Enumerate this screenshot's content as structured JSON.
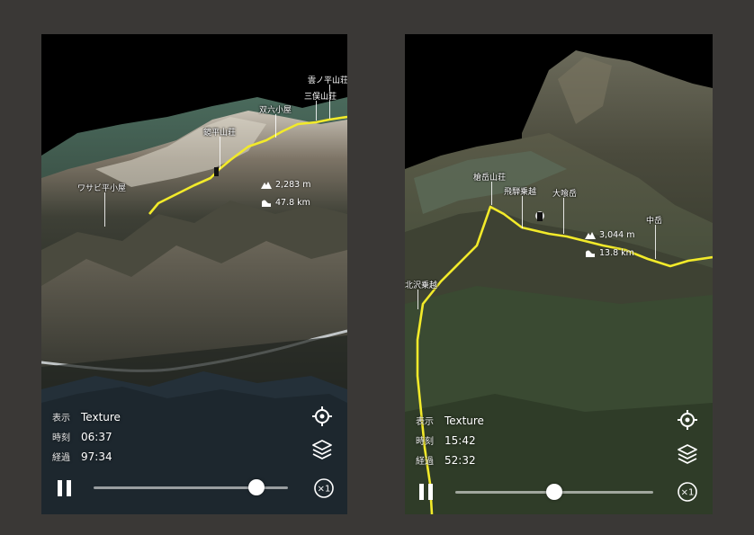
{
  "left": {
    "labels": {
      "kumonotaira": "雲ノ平山荘",
      "mitsumata": "三俣山荘",
      "sugoroku": "双六小屋",
      "kagami": "鏡平山荘",
      "wasabi": "ワサビ平小屋"
    },
    "elevation": "2,283 m",
    "distance": "47.8 km",
    "info": {
      "display_key": "表示",
      "display_value": "Texture",
      "time_key": "時刻",
      "time_value": "06:37",
      "elapsed_key": "経過",
      "elapsed_value": "97:34"
    },
    "playback": {
      "progress": 0.84,
      "speed_label": "×1",
      "state": "paused"
    }
  },
  "right": {
    "labels": {
      "yarigatake": "槍岳山荘",
      "hida": "飛騨乗越",
      "obami": "大喰岳",
      "naka": "中岳",
      "kitasawa": "北沢乗越"
    },
    "elevation": "3,044 m",
    "distance": "13.8 km",
    "info": {
      "display_key": "表示",
      "display_value": "Texture",
      "time_key": "時刻",
      "time_value": "15:42",
      "elapsed_key": "経過",
      "elapsed_value": "52:32"
    },
    "playback": {
      "progress": 0.5,
      "speed_label": "×1",
      "state": "paused"
    }
  },
  "colors": {
    "route": "#f2ea2a",
    "hud_text": "#ffffff",
    "frame": "#3a3836"
  },
  "icons": [
    "mountain-icon",
    "distance-icon",
    "pause-icon",
    "locate-icon",
    "layers-icon",
    "speed-icon"
  ]
}
